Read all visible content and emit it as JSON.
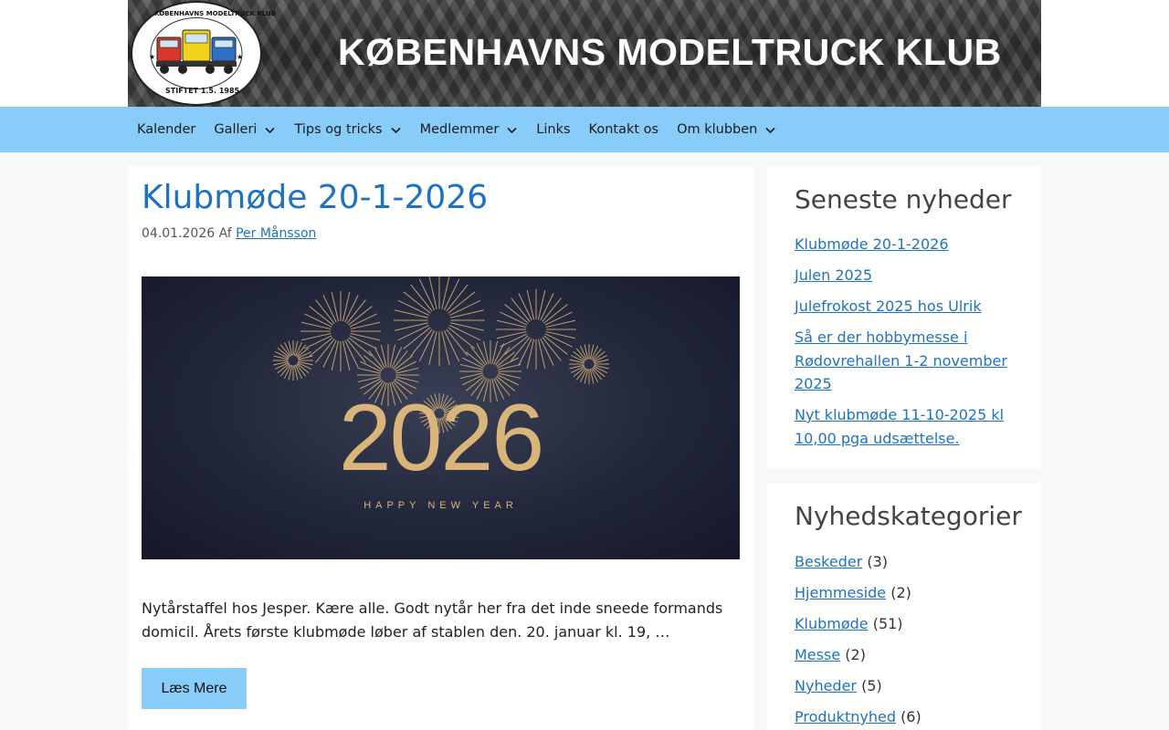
{
  "header": {
    "banner_title": "KØBENHAVNS MODELTRUCK KLUB",
    "logo_text_top": "KØBENHAVNS MODELTRUCK KLUB",
    "logo_text_bottom": "STIFTET 1.5. 1985"
  },
  "nav": {
    "items": [
      {
        "label": "Kalender",
        "has_submenu": false
      },
      {
        "label": "Galleri",
        "has_submenu": true
      },
      {
        "label": "Tips og tricks",
        "has_submenu": true
      },
      {
        "label": "Medlemmer",
        "has_submenu": true
      },
      {
        "label": "Links",
        "has_submenu": false
      },
      {
        "label": "Kontakt os",
        "has_submenu": false
      },
      {
        "label": "Om klubben",
        "has_submenu": true
      }
    ]
  },
  "post": {
    "title": "Klubmøde 20-1-2026",
    "date": "04.01.2026",
    "by_label": "Af",
    "author": "Per Månsson",
    "image": {
      "year_text": "2026",
      "subtitle_text": "HAPPY NEW YEAR"
    },
    "excerpt": "Nytårstaffel hos Jesper. Kære alle. Godt nytår her fra det inde sneede formands domicil. Årets første klubmøde løber af stablen den. 20. januar kl. 19, …",
    "read_more_label": "Læs Mere"
  },
  "sidebar": {
    "recent": {
      "title": "Seneste nyheder",
      "items": [
        "Klubmøde 20-1-2026",
        "Julen 2025",
        "Julefrokost 2025 hos Ulrik",
        "Så er der hobbymesse i Rødovrehallen 1-2 november 2025",
        "Nyt klubmøde 11-10-2025 kl 10,00 pga udsættelse."
      ]
    },
    "categories": {
      "title": "Nyhedskategorier",
      "items": [
        {
          "label": "Beskeder",
          "count": "(3)"
        },
        {
          "label": "Hjemmeside",
          "count": "(2)"
        },
        {
          "label": "Klubmøde",
          "count": "(51)"
        },
        {
          "label": "Messe",
          "count": "(2)"
        },
        {
          "label": "Nyheder",
          "count": "(5)"
        },
        {
          "label": "Produktnyhed",
          "count": "(6)"
        }
      ]
    }
  },
  "colors": {
    "nav_bg": "#88ccfa",
    "link": "#1e73be",
    "gold": "#d9b57a"
  }
}
